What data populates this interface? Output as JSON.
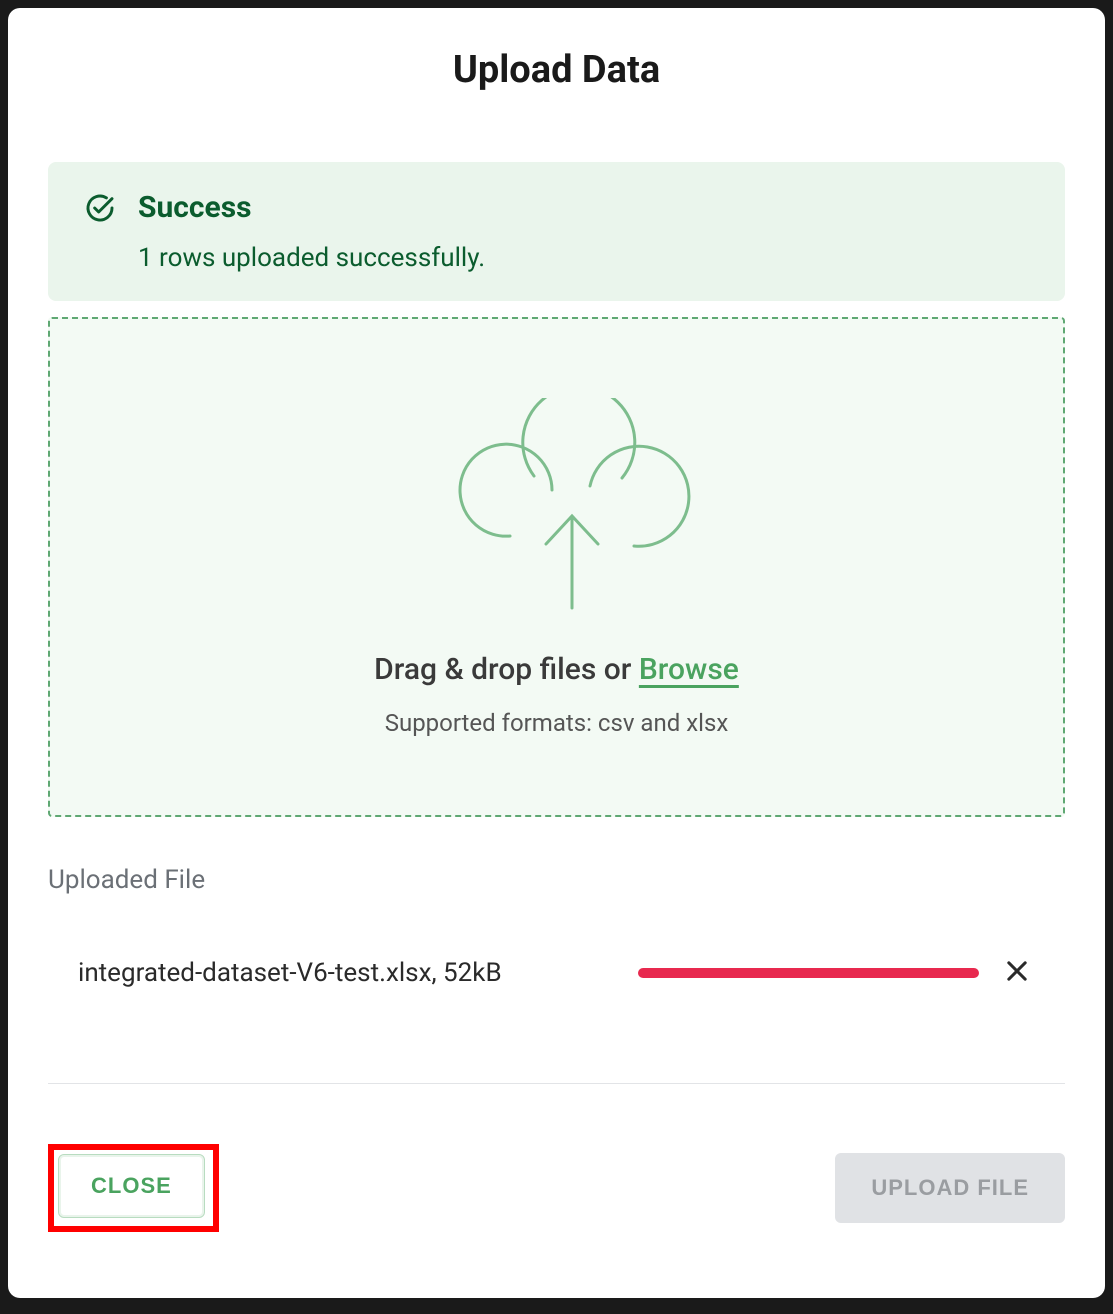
{
  "modal": {
    "title": "Upload Data"
  },
  "alert": {
    "title": "Success",
    "message": "1 rows uploaded successfully."
  },
  "dropzone": {
    "prefix_text": "Drag & drop files or ",
    "browse_label": "Browse",
    "supported_text": "Supported formats: csv and xlsx"
  },
  "uploaded": {
    "section_label": "Uploaded File",
    "file_label": "integrated-dataset-V6-test.xlsx, 52kB"
  },
  "footer": {
    "close_label": "CLOSE",
    "upload_label": "UPLOAD FILE"
  },
  "colors": {
    "success_green": "#0b5c2e",
    "accent_green": "#4aa35f",
    "progress_red": "#e8294f",
    "highlight_red": "#ff0000"
  }
}
